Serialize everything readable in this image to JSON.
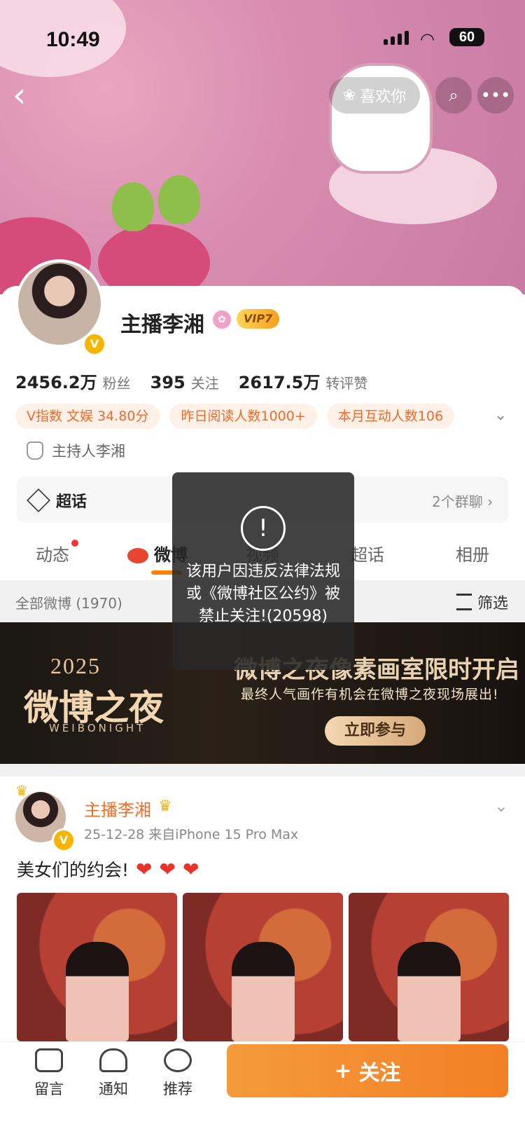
{
  "status_bar": {
    "time": "10:49",
    "battery": "60"
  },
  "header": {
    "like_label": "喜欢你"
  },
  "profile": {
    "name": "主播李湘",
    "vip": "VIP7",
    "stats": [
      {
        "value": "2456.2万",
        "label": "粉丝"
      },
      {
        "value": "395",
        "label": "关注"
      },
      {
        "value": "2617.5万",
        "label": "转评赞"
      }
    ],
    "tags": [
      "V指数 文娱 34.80分",
      "昨日阅读人数1000+",
      "本月互动人数106"
    ],
    "role": "主持人李湘"
  },
  "chao": {
    "left_label": "超话",
    "right_label": "2个群聊 ›"
  },
  "tabs": [
    {
      "label": "动态"
    },
    {
      "label": "微博"
    },
    {
      "label": "视频"
    },
    {
      "label": "超话"
    },
    {
      "label": "相册"
    }
  ],
  "filter": {
    "left": "全部微博 (1970)",
    "right": "筛选"
  },
  "promo": {
    "year": "2025",
    "title": "微博之夜",
    "subtitle": "WEIBONIGHT",
    "headline": "微博之夜像素画室限时开启",
    "desc": "最终人气画作有机会在微博之夜现场展出!",
    "button": "立即参与"
  },
  "post": {
    "author": "主播李湘",
    "meta": "25-12-28  来自iPhone 15 Pro Max",
    "text": "美女们的约会!"
  },
  "bottom_bar": {
    "comment": "留言",
    "notify": "通知",
    "recommend": "推荐",
    "follow": "关注"
  },
  "toast": {
    "text": "该用户因违反法律法规或《微博社区公约》被禁止关注!(20598)"
  },
  "colors": {
    "accent": "#ff8200",
    "tag_text": "#ef6b2c",
    "follow_button": "#f37f24"
  }
}
